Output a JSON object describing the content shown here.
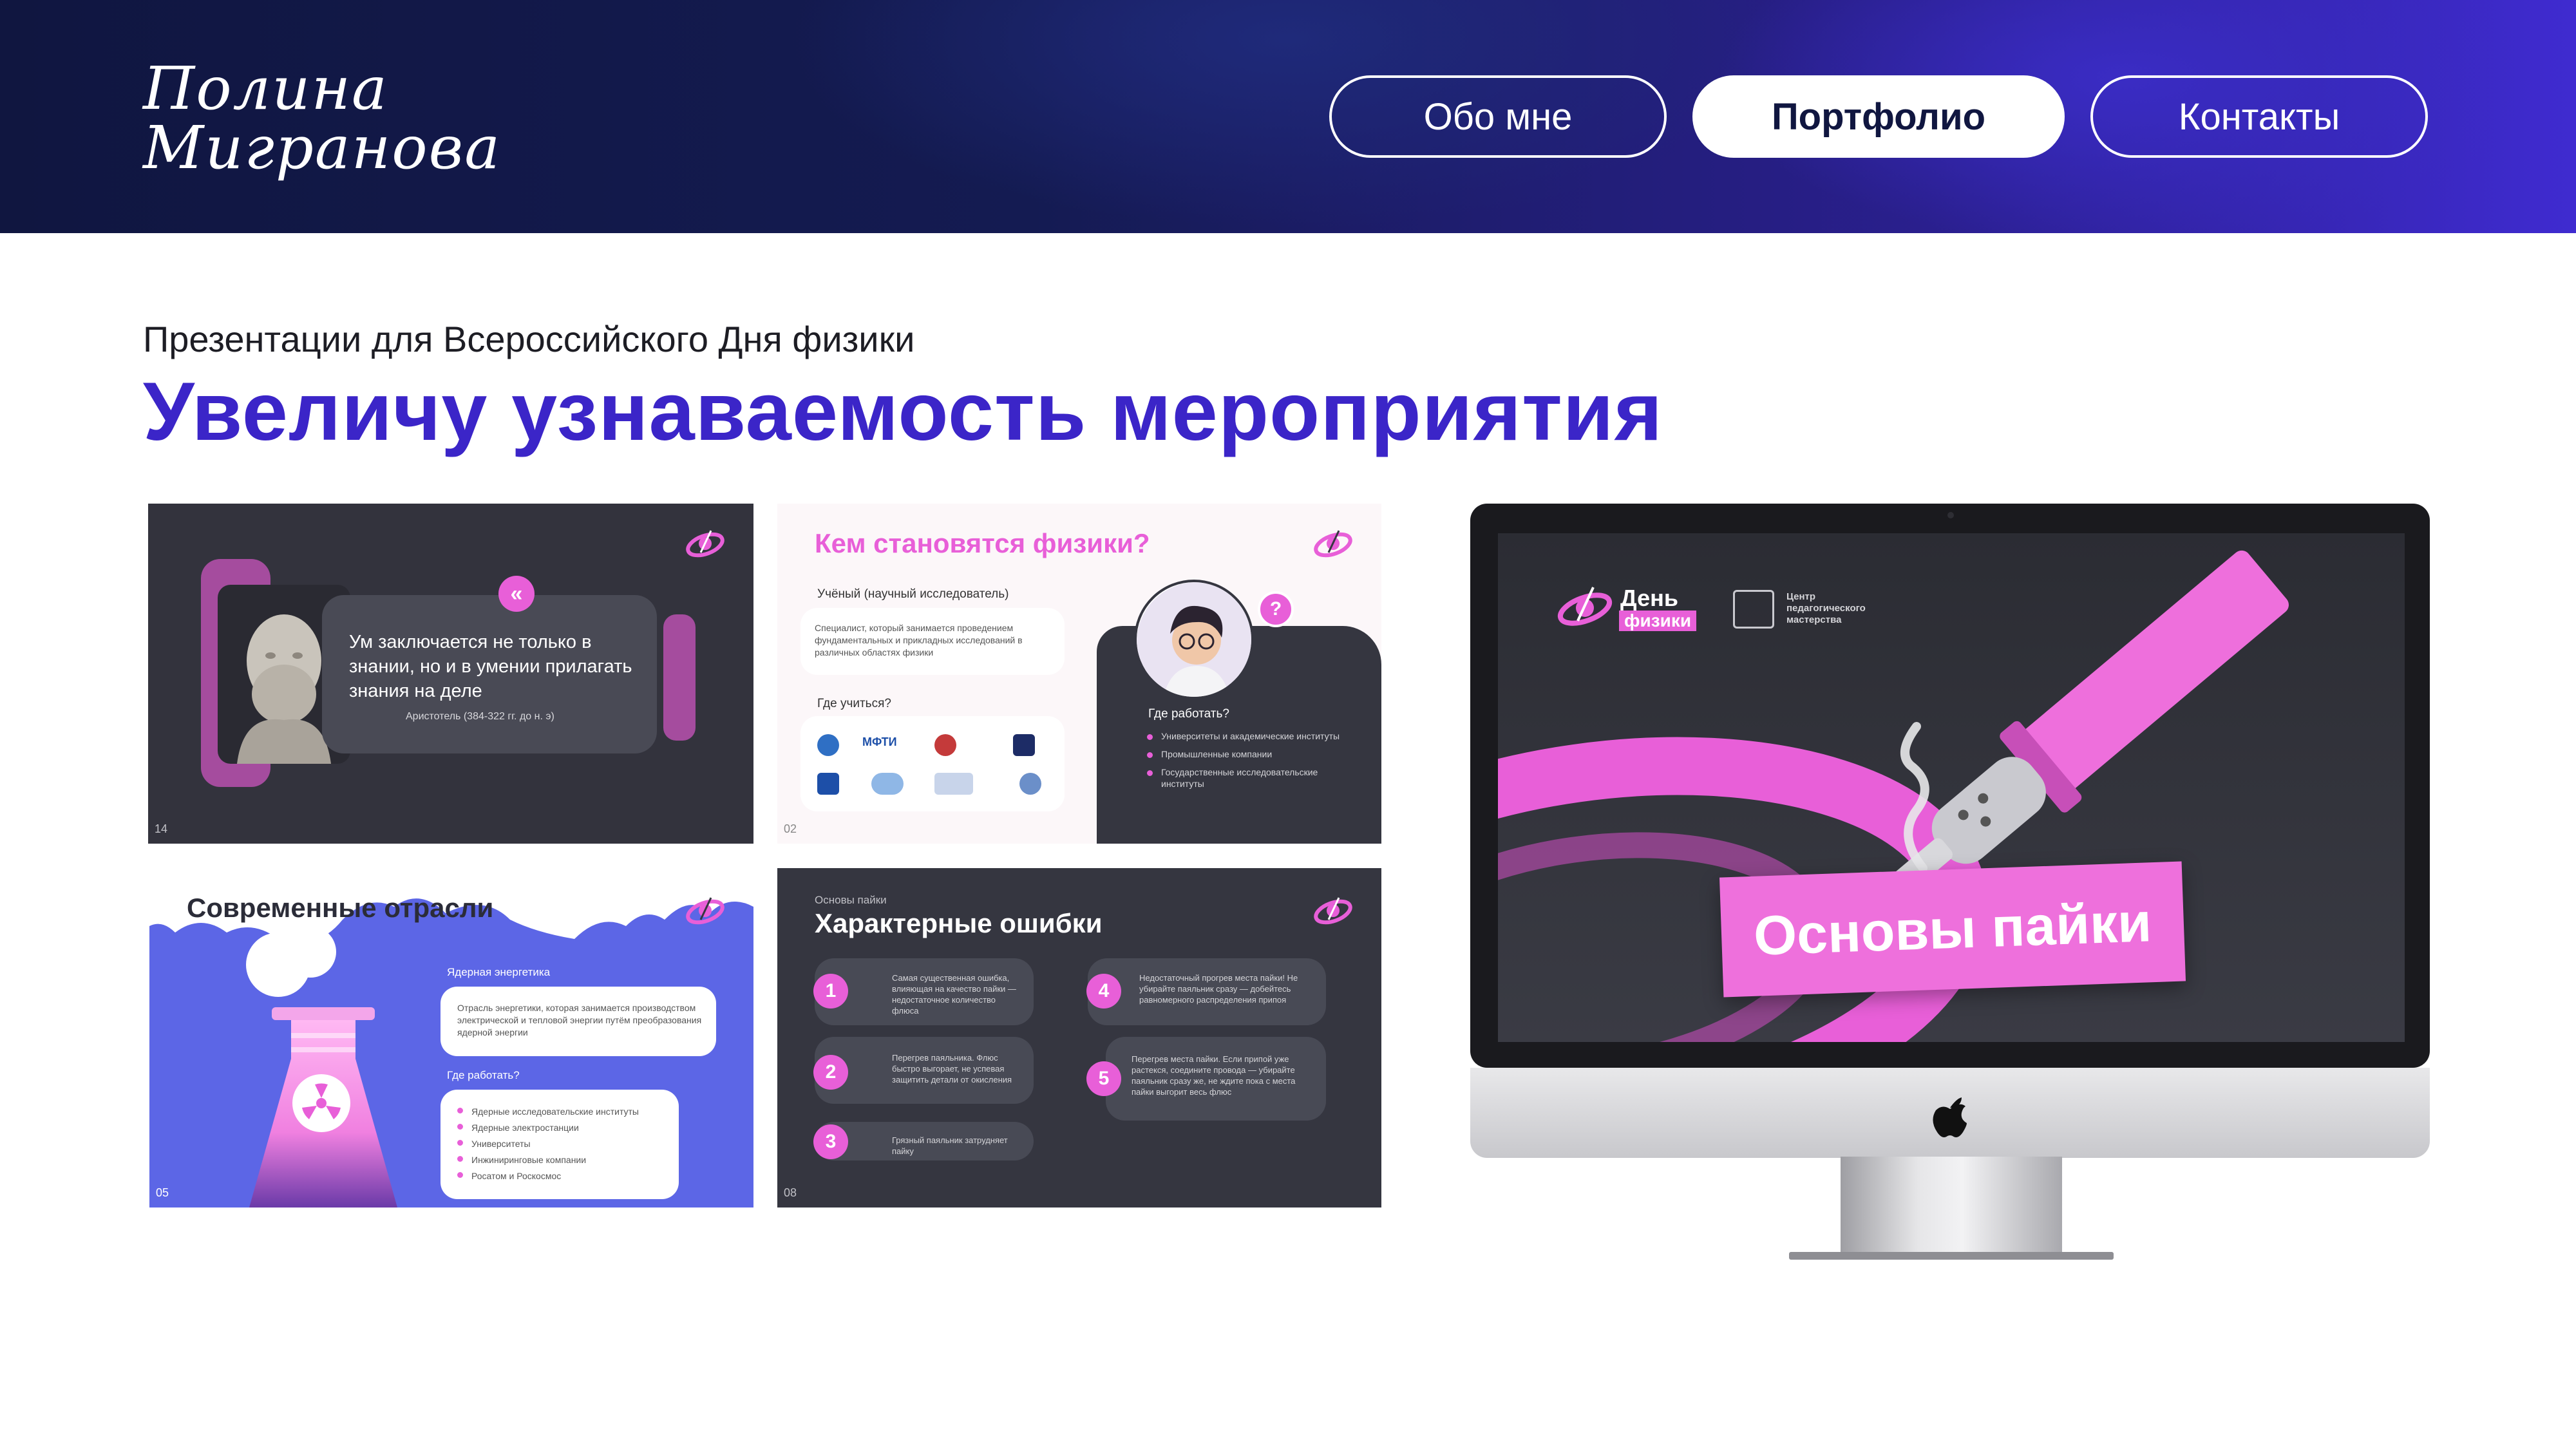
{
  "header": {
    "logo_line1": "Полина",
    "logo_line2": "Мигранова",
    "nav": [
      {
        "label": "Обо мне",
        "active": false
      },
      {
        "label": "Портфолио",
        "active": true
      },
      {
        "label": "Контакты",
        "active": false
      }
    ]
  },
  "main": {
    "subtitle": "Презентации для Всероссийского Дня физики",
    "headline": "Увеличу узнаваемость мероприятия"
  },
  "slides": {
    "quote": {
      "text": "Ум заключается не только в знании, но и в умении прилагать знания на деле",
      "author": "Аристотель (384-322 гг. до н. э)",
      "page": "14"
    },
    "careers": {
      "title": "Кем становятся физики?",
      "role_title": "Учёный (научный исследователь)",
      "role_text": "Специалист, который занимается проведением фундаментальных и прикладных исследований в различных областях физики",
      "study_title": "Где учиться?",
      "logos": [
        "МФТИ"
      ],
      "work_title": "Где работать?",
      "work_items": [
        "Университеты и академические институты",
        "Промышленные компании",
        "Государственные исследовательские институты"
      ],
      "question_mark": "?",
      "page": "02"
    },
    "industries": {
      "title": "Современные отрасли",
      "card_title": "Ядерная энергетика",
      "card_text": "Отрасль энергетики, которая занимается производством электрической и тепловой энергии путём преобразования ядерной энергии",
      "work_title": "Где работать?",
      "work_items": [
        "Ядерные исследовательские институты",
        "Ядерные электростанции",
        "Университеты",
        "Инжиниринговые компании",
        "Росатом и Роскосмос"
      ],
      "page": "05"
    },
    "mistakes": {
      "kicker": "Основы пайки",
      "title": "Характерные ошибки",
      "items": [
        {
          "n": "1",
          "text": "Самая существенная ошибка, влияющая на качество пайки — недостаточное количество флюса"
        },
        {
          "n": "2",
          "text": "Перегрев паяльника. Флюс быстро выгорает, не успевая защитить детали от окисления"
        },
        {
          "n": "3",
          "text": "Грязный паяльник затрудняет пайку"
        },
        {
          "n": "4",
          "text": "Недостаточный прогрев места пайки! Не убирайте паяльник сразу — добейтесь равномерного распределения припоя"
        },
        {
          "n": "5",
          "text": "Перегрев места пайки. Если припой уже растекся, соедините провода — убирайте паяльник сразу же, не ждите пока с места пайки выгорит весь флюс"
        }
      ],
      "page": "08"
    },
    "monitor": {
      "event_line1": "День",
      "event_line2": "физики",
      "partner": "Центр педагогического мастерства",
      "banner": "Основы пайки"
    }
  },
  "colors": {
    "accent_purple": "#3b25c8",
    "pink": "#e85fd8",
    "dark_slide": "#33333d"
  },
  "icons": [
    "apple-icon",
    "soldering-iron-icon",
    "atom-logo-icon",
    "radiation-icon"
  ]
}
